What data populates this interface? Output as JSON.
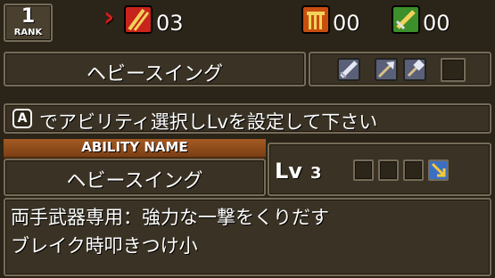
{
  "rank": {
    "value": "1",
    "label": "RANK"
  },
  "counters": {
    "arrow_glyph": "›",
    "red_count": "03",
    "orange_count": "00",
    "green_count": "00"
  },
  "ability": {
    "selected_name": "ヘビースイング",
    "section_header": "ABILITY NAME",
    "name": "ヘビースイング",
    "level_prefix": "Lv",
    "level_value": "3",
    "description_line1": "両手武器専用：強力な一撃をくりだす",
    "description_line2": "ブレイク時叩きつけ小"
  },
  "instruction": {
    "button_glyph": "A",
    "text": "でアビリティ選択しLvを設定して下さい"
  },
  "weapon_icons": [
    "greatsword-icon",
    "battle-axe-icon",
    "hammer-icon"
  ],
  "colors": {
    "panel_bg": "#3a3224",
    "panel_border": "#756b58",
    "header_bar": "#8c4e1d",
    "red_icon": "#c8241c",
    "orange_icon": "#c84e10",
    "green_icon": "#3c8f2a"
  }
}
